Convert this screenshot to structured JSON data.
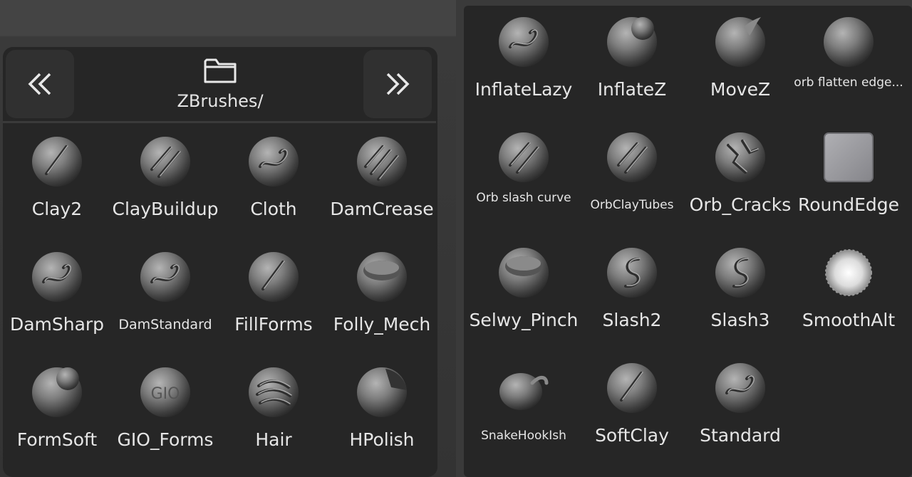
{
  "left_panel": {
    "prev_label": "«",
    "next_label": "»",
    "folder_icon": "folder-icon",
    "folder_path": "ZBrushes/",
    "brushes": [
      {
        "label": "Clay2",
        "color": "white",
        "icon": "clay-brush-icon"
      },
      {
        "label": "ClayBuildup",
        "color": "white",
        "icon": "clay-buildup-brush-icon"
      },
      {
        "label": "Cloth",
        "color": "white",
        "icon": "cloth-brush-icon"
      },
      {
        "label": "DamCrease",
        "color": "orange",
        "icon": "dam-crease-brush-icon"
      },
      {
        "label": "DamSharp",
        "color": "white",
        "icon": "dam-sharp-brush-icon"
      },
      {
        "label": "DamStandard",
        "color": "white",
        "icon": "dam-standard-brush-icon"
      },
      {
        "label": "FillForms",
        "color": "green",
        "icon": "fill-forms-brush-icon"
      },
      {
        "label": "Folly_Mech",
        "color": "orange",
        "icon": "folly-mech-brush-icon"
      },
      {
        "label": "FormSoft",
        "color": "green",
        "icon": "form-soft-brush-icon"
      },
      {
        "label": "GIO_Forms",
        "color": "orange",
        "icon": "gio-forms-brush-icon"
      },
      {
        "label": "Hair",
        "color": "orange",
        "icon": "hair-brush-icon"
      },
      {
        "label": "HPolish",
        "color": "green",
        "icon": "hpolish-brush-icon"
      }
    ]
  },
  "right_panel": {
    "brushes": [
      {
        "label": "InflateLazy",
        "color": "white",
        "icon": "inflate-lazy-brush-icon"
      },
      {
        "label": "InflateZ",
        "color": "white",
        "icon": "inflate-z-brush-icon"
      },
      {
        "label": "MoveZ",
        "color": "purple",
        "icon": "move-z-brush-icon"
      },
      {
        "label": "orb flatten edge...",
        "color": "green",
        "icon": "orb-flatten-edge-brush-icon"
      },
      {
        "label": "Orb slash curve",
        "color": "white",
        "icon": "orb-slash-curve-brush-icon"
      },
      {
        "label": "OrbClayTubes",
        "color": "white",
        "icon": "orb-clay-tubes-brush-icon"
      },
      {
        "label": "Orb_Cracks",
        "color": "orange",
        "icon": "orb-cracks-brush-icon"
      },
      {
        "label": "RoundEdge",
        "color": "white",
        "icon": "round-edge-brush-icon"
      },
      {
        "label": "Selwy_Pinch",
        "color": "orange",
        "icon": "selwy-pinch-brush-icon"
      },
      {
        "label": "Slash2",
        "color": "orange",
        "icon": "slash2-brush-icon"
      },
      {
        "label": "Slash3",
        "color": "orange",
        "icon": "slash3-brush-icon"
      },
      {
        "label": "SmoothAlt",
        "color": "white",
        "icon": "smooth-alt-brush-icon"
      },
      {
        "label": "SnakeHookIsh",
        "color": "purple",
        "icon": "snake-hook-ish-brush-icon"
      },
      {
        "label": "SoftClay",
        "color": "white",
        "icon": "soft-clay-brush-icon"
      },
      {
        "label": "Standard",
        "color": "white",
        "icon": "standard-brush-icon"
      }
    ]
  },
  "colors": {
    "panel_bg": "#262626",
    "label_white": "#e6e6e6",
    "label_orange": "#e8a07c",
    "label_green": "#8fcf70",
    "label_purple": "#9b8ee0"
  }
}
